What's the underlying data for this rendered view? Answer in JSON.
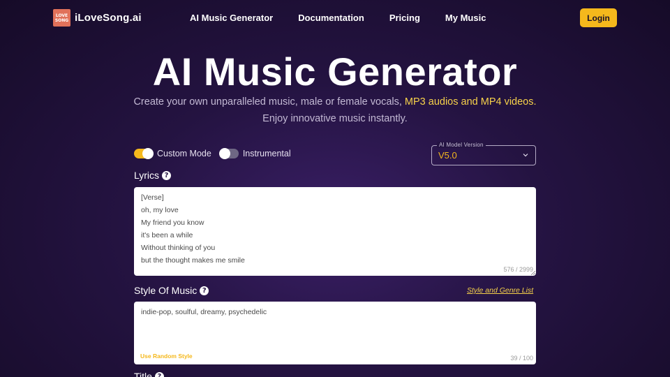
{
  "brand": {
    "logo_line1": "LOVE",
    "logo_line2": "SONG",
    "name": "iLoveSong.ai"
  },
  "nav": [
    "AI Music Generator",
    "Documentation",
    "Pricing",
    "My Music"
  ],
  "login_label": "Login",
  "hero": {
    "title": "AI Music Generator",
    "subtitle_plain": "Create your own unparalleled music, male or female vocals, ",
    "subtitle_highlight": "MP3 audios and MP4 videos.",
    "subtitle_line2": "Enjoy innovative music instantly."
  },
  "toggles": {
    "custom_mode": {
      "label": "Custom Mode",
      "on": true
    },
    "instrumental": {
      "label": "Instrumental",
      "on": false
    }
  },
  "model": {
    "legend": "AI Model Version",
    "value": "V5.0"
  },
  "lyrics": {
    "label": "Lyrics",
    "lines": [
      "[Verse]",
      "oh, my love",
      "My friend you know",
      "it's been a while",
      "Without thinking of you",
      "but the thought makes me smile"
    ],
    "counter": "576 / 2999"
  },
  "style": {
    "label": "Style Of Music",
    "genre_link": "Style and Genre List",
    "value": "indie-pop, soulful, dreamy, psychedelic",
    "random_label": "Use Random Style",
    "counter": "39 / 100"
  },
  "title_field": {
    "label": "Title"
  },
  "colors": {
    "accent": "#f5b81c",
    "highlight": "#f7d24a",
    "bg": "#241341"
  }
}
